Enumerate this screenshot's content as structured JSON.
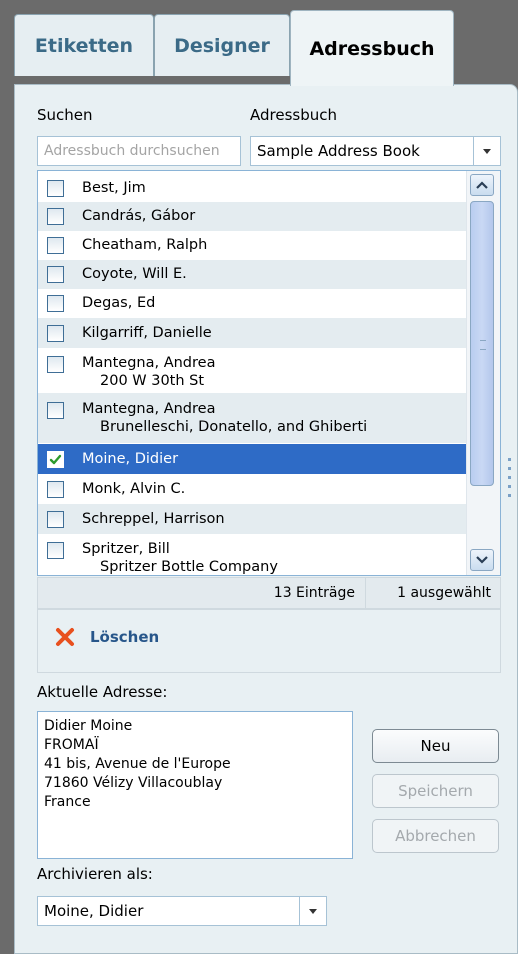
{
  "tabs": [
    {
      "label": "Etiketten",
      "active": false
    },
    {
      "label": "Designer",
      "active": false
    },
    {
      "label": "Adressbuch",
      "active": true
    }
  ],
  "search": {
    "label": "Suchen",
    "placeholder": "Adressbuch durchsuchen",
    "value": ""
  },
  "addressbook": {
    "label": "Adressbuch",
    "selected": "Sample Address Book"
  },
  "contacts": [
    {
      "name": "Best, Jim",
      "sub": "",
      "checked": false
    },
    {
      "name": "Candrás, Gábor",
      "sub": "",
      "checked": false
    },
    {
      "name": "Cheatham, Ralph",
      "sub": "",
      "checked": false
    },
    {
      "name": "Coyote, Will E.",
      "sub": "",
      "checked": false
    },
    {
      "name": "Degas, Ed",
      "sub": "",
      "checked": false
    },
    {
      "name": "Kilgarriff, Danielle",
      "sub": "",
      "checked": false
    },
    {
      "name": "Mantegna, Andrea",
      "sub": "200 W 30th St",
      "checked": false
    },
    {
      "name": "Mantegna, Andrea",
      "sub": "Brunelleschi, Donatello, and Ghiberti",
      "checked": false
    },
    {
      "name": "Moine, Didier",
      "sub": "",
      "checked": true
    },
    {
      "name": "Monk, Alvin C.",
      "sub": "",
      "checked": false
    },
    {
      "name": "Schreppel, Harrison",
      "sub": "",
      "checked": false
    },
    {
      "name": "Spritzer, Bill",
      "sub": "Spritzer Bottle Company",
      "checked": false
    }
  ],
  "status": {
    "count": "13 Einträge",
    "selected": "1 ausgewählt"
  },
  "delete_label": "Löschen",
  "current_address": {
    "label": "Aktuelle Adresse:",
    "text": "Didier Moine\nFROMAÏ\n41 bis, Avenue de l'Europe\n71860 Vélizy Villacoublay\nFrance"
  },
  "buttons": {
    "new": "Neu",
    "save": "Speichern",
    "cancel": "Abbrechen"
  },
  "archive": {
    "label": "Archivieren als:",
    "selected": "Moine, Didier"
  },
  "colors": {
    "accent": "#2e6bc6",
    "tab_text": "#3b6a87",
    "panel_bg": "#e8f0f3",
    "delete_x": "#e8501e"
  }
}
